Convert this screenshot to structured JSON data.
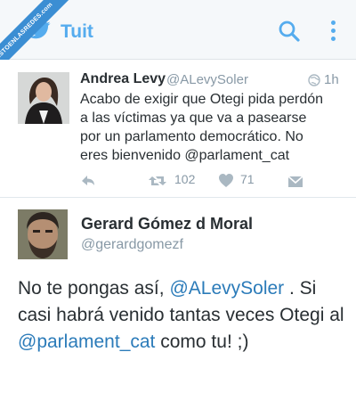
{
  "appbar": {
    "title": "Tuit",
    "accent": "#55acee",
    "icons": [
      "twitter-bird-icon",
      "search-icon",
      "more-vertical-icon"
    ]
  },
  "watermark": {
    "text": "VISTOENLASREDES",
    "subtext": ".com"
  },
  "tweets": [
    {
      "name": "Andrea Levy",
      "handle": "@ALevySoler",
      "time": "1h",
      "lines": [
        "Acabo de exigir que Otegi pida perdón",
        "a las víctimas ya que va a pasearse",
        "por un parlamento democrático. No",
        "eres bienvenido @parlament_cat"
      ],
      "retweets": "102",
      "likes": "71"
    },
    {
      "name": "Gerard Gómez d Moral",
      "handle": "@gerardgomezf",
      "text_parts": {
        "p1": "No te pongas así, ",
        "mention1": "@ALevySoler",
        "p2": " . Si casi habrá venido tantas veces Otegi al ",
        "mention2": "@parlament_cat",
        "p3": " como tu! ;)"
      }
    }
  ]
}
